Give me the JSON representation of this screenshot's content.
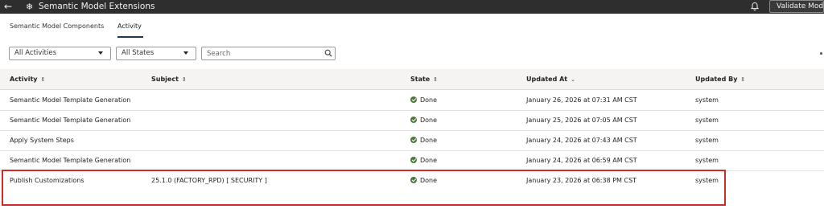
{
  "header": {
    "back_icon": "back-arrow-icon",
    "app_icon": "snowflake-icon",
    "title": "Semantic Model Extensions",
    "notification_icon": "bell-icon",
    "validate_label": "Validate Model"
  },
  "tabs": [
    {
      "label": "Semantic Model Components",
      "selected": false
    },
    {
      "label": "Activity",
      "selected": true
    }
  ],
  "filters": {
    "activities_value": "All Activities",
    "states_value": "All States",
    "search_placeholder": "Search"
  },
  "table": {
    "columns": [
      {
        "label": "Activity",
        "sort": "sortable"
      },
      {
        "label": "Subject",
        "sort": "sortable"
      },
      {
        "label": "State",
        "sort": "sortable"
      },
      {
        "label": "Updated At",
        "sort": "descending"
      },
      {
        "label": "Updated By",
        "sort": "sortable"
      }
    ],
    "rows": [
      {
        "activity": "Semantic Model Template Generation",
        "subject": "",
        "state": "Done",
        "updated_at": "January 26, 2026 at 07:31 AM CST",
        "updated_by": "system"
      },
      {
        "activity": "Semantic Model Template Generation",
        "subject": "",
        "state": "Done",
        "updated_at": "January 25, 2026 at 07:05 AM CST",
        "updated_by": "system"
      },
      {
        "activity": "Apply System Steps",
        "subject": "",
        "state": "Done",
        "updated_at": "January 24, 2026 at 07:43 AM CST",
        "updated_by": "system"
      },
      {
        "activity": "Semantic Model Template Generation",
        "subject": "",
        "state": "Done",
        "updated_at": "January 24, 2026 at 06:59 AM CST",
        "updated_by": "system"
      },
      {
        "activity": "Publish Customizations",
        "subject": "25.1.0 (FACTORY_RPD) [ SECURITY ]",
        "state": "Done",
        "updated_at": "January 23, 2026 at 06:38 PM CST",
        "updated_by": "system"
      }
    ]
  },
  "colors": {
    "topbar": "#2e2e2e",
    "done_icon": "#4a7a3b",
    "highlight_border": "#d02b2b"
  }
}
